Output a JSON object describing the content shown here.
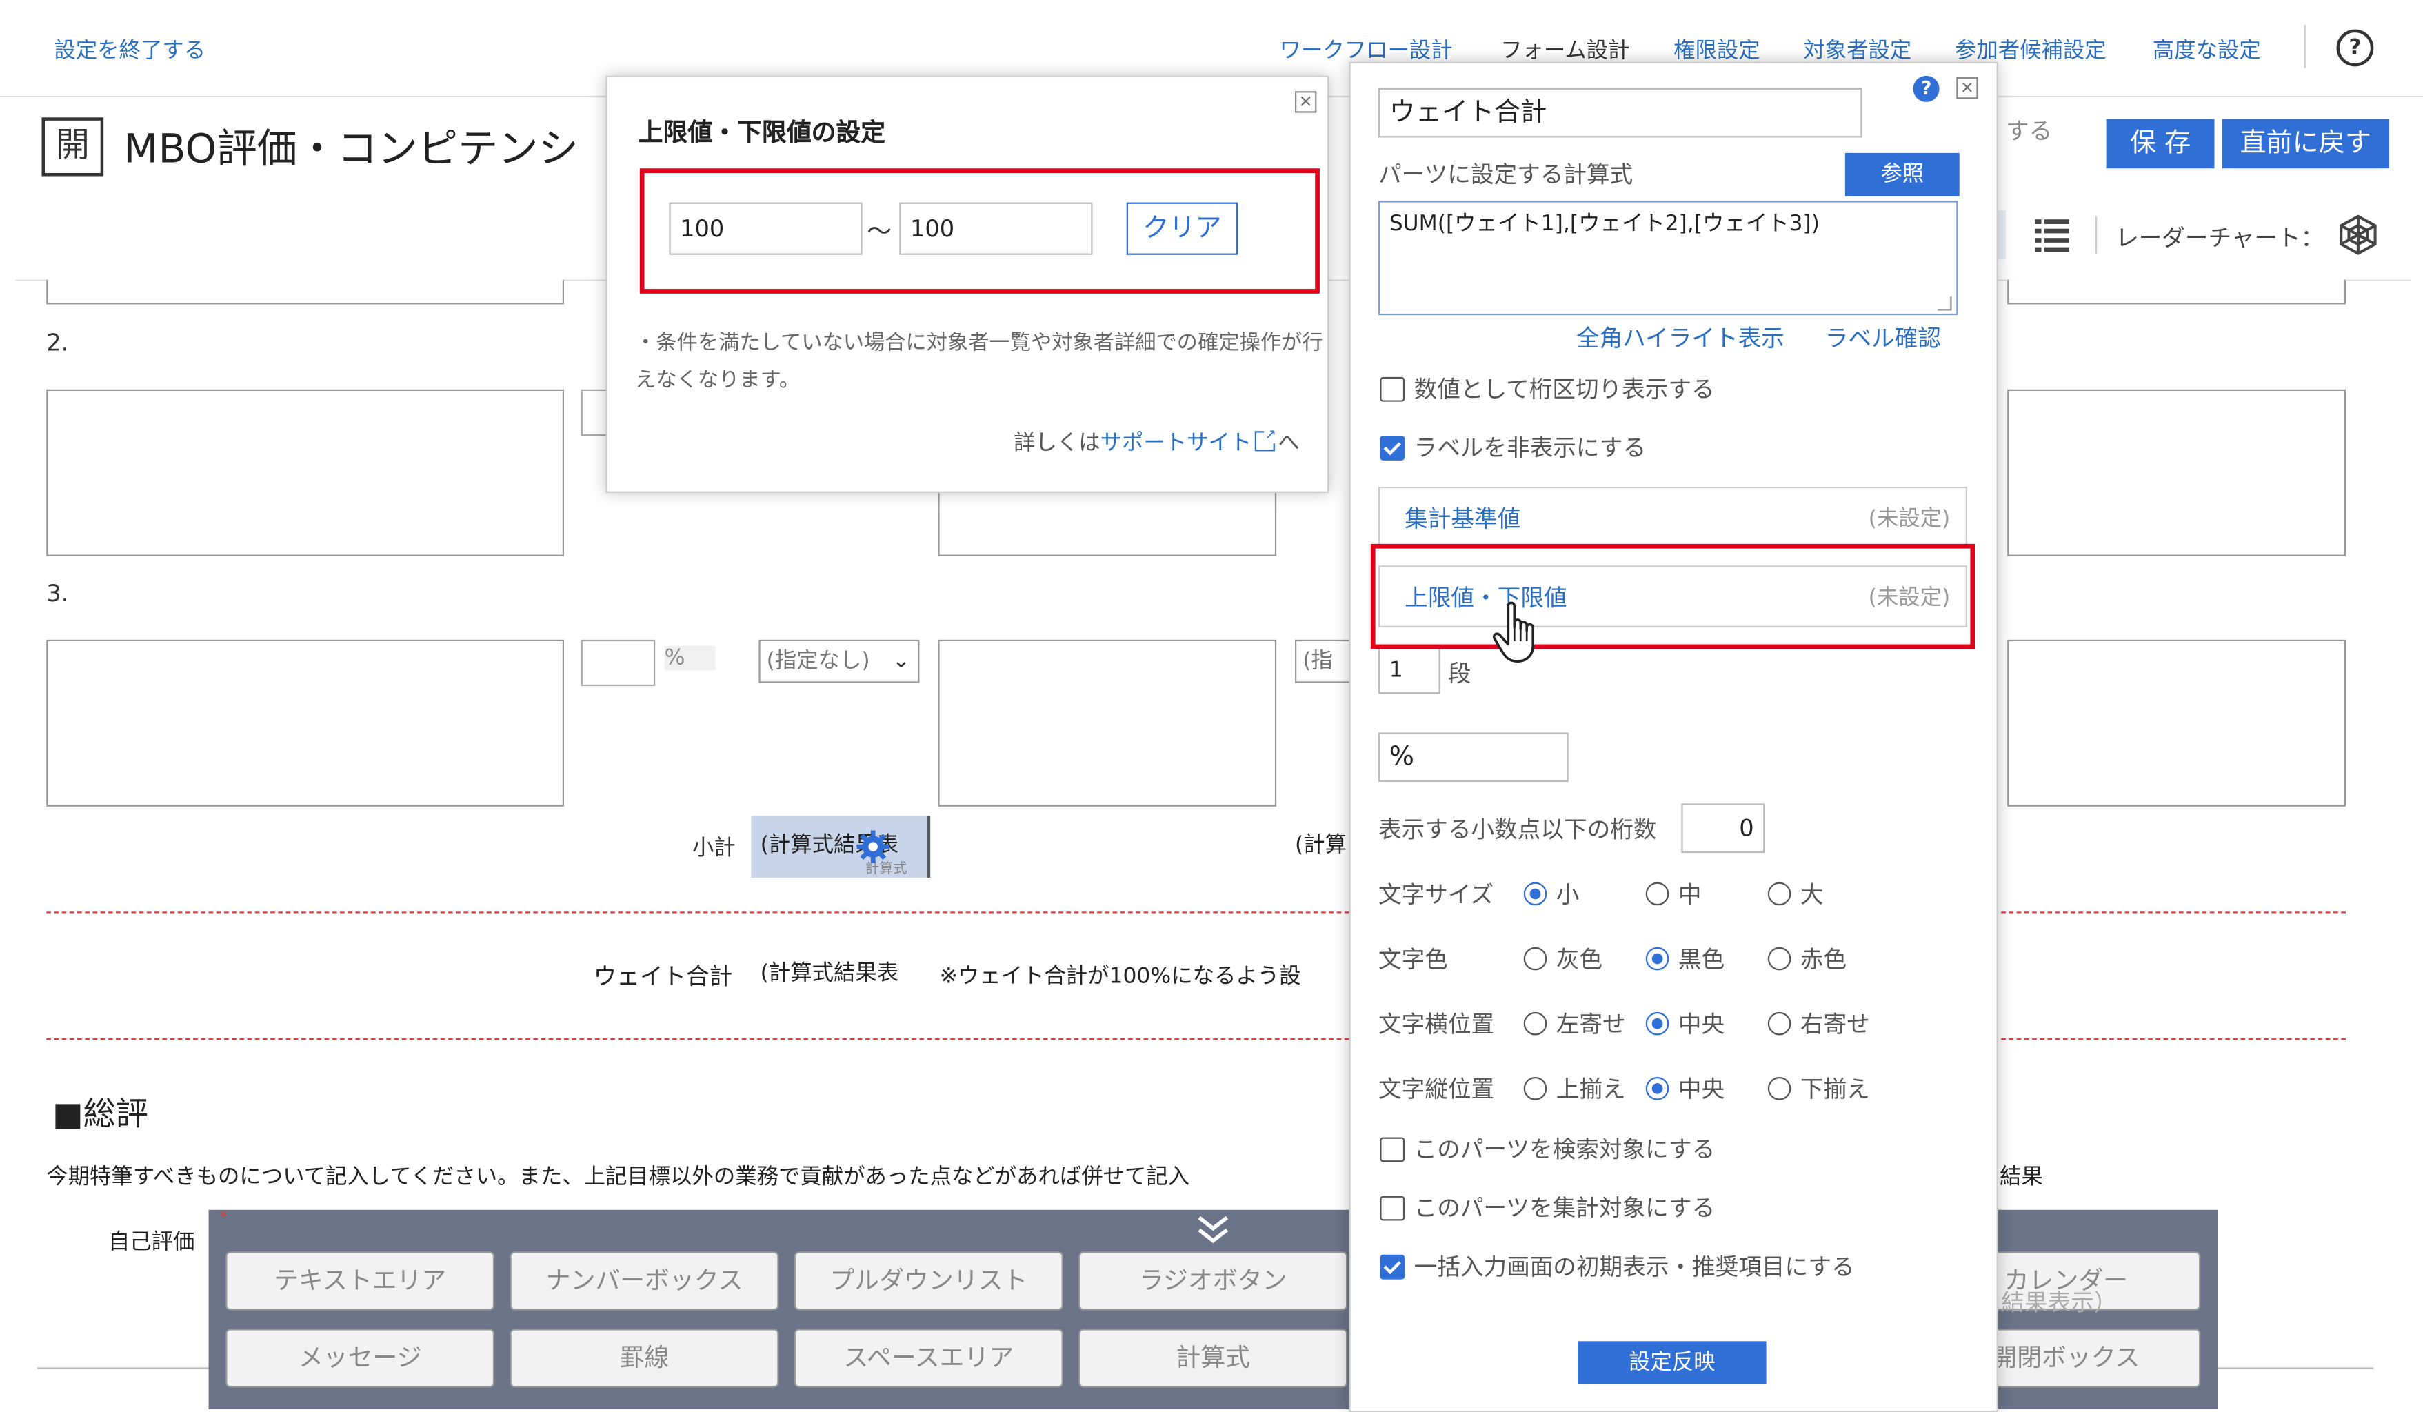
{
  "topbar": {
    "exit_link": "設定を終了する",
    "nav": [
      "ワークフロー設計",
      "フォーム設計",
      "権限設定",
      "対象者設定",
      "参加者候補設定",
      "高度な設定"
    ],
    "help_icon": "question-circle-icon"
  },
  "header": {
    "badge": "開",
    "title": "MBO評価・コンピテンシ",
    "partial_text": "する",
    "save_label": "保 存",
    "revert_label": "直前に戻す",
    "radar_label": "レーダーチャート：",
    "list_icon": "list-icon",
    "radar_icon": "hexagon-icon"
  },
  "form": {
    "row2_label": "2.",
    "row3_label": "3.",
    "percent": "%",
    "select_none": "(指定なし)",
    "select_partial": "(指定",
    "select_partial2": "(指",
    "subtotal_label": "小計",
    "subtotal_value": "(計算式結果表",
    "subtotal_sub": "計算式",
    "subtotal_partial": "(計算",
    "weight_label": "ウェイト合計",
    "weight_value": "(計算式結果表",
    "weight_note": "※ウェイト合計が100%になるよう設",
    "section_title": "■総評",
    "section_desc": "今期特筆すべきものについて記入してください。また、上記目標以外の業務で貢献があった点などがあれば併せて記入",
    "section_desc_tail": "結果",
    "self_eval": "自己評価",
    "behind_palette_1": "結果表示）"
  },
  "palette": {
    "collapse_icon": "double-chevron-down-icon",
    "row1": [
      "テキストエリア",
      "ナンバーボックス",
      "プルダウンリスト",
      "ラジオボタン"
    ],
    "row2": [
      "メッセージ",
      "罫線",
      "スペースエリア",
      "計算式"
    ],
    "right_row1": "カレンダー",
    "right_row2": "開閉ボックス"
  },
  "limit_popup": {
    "title": "上限値・下限値の設定",
    "close_icon": "close-icon",
    "lower_value": "100",
    "tilde": "～",
    "upper_value": "100",
    "clear_label": "クリア",
    "note": "・条件を満たしていない場合に対象者一覧や対象者詳細での確定操作が行えなくなります。",
    "more_prefix": "詳しくは",
    "more_link": "サポートサイト",
    "more_suffix": "へ",
    "external_icon": "external-link-icon"
  },
  "settings_panel": {
    "help_icon": "question-icon",
    "close_icon": "close-icon",
    "name_value": "ウェイト合計",
    "formula_label": "パーツに設定する計算式",
    "ref_label": "参照",
    "formula_value": "SUM([ウェイト1],[ウェイト2],[ウェイト3])",
    "highlight_link": "全角ハイライト表示",
    "label_check_link": "ラベル確認",
    "chk_separator": "数値として桁区切り表示する",
    "chk_hide_label": "ラベルを非表示にする",
    "agg_base_label": "集計基準値",
    "agg_base_status": "(未設定)",
    "limit_label": "上限値・下限値",
    "limit_status": "(未設定)",
    "rows_value": "1",
    "rows_unit": "段",
    "unit_value": "%",
    "decimals_label": "表示する小数点以下の桁数",
    "decimals_value": "0",
    "font_size_label": "文字サイズ",
    "font_size_options": [
      "小",
      "中",
      "大"
    ],
    "font_color_label": "文字色",
    "font_color_options": [
      "灰色",
      "黒色",
      "赤色"
    ],
    "halign_label": "文字横位置",
    "halign_options": [
      "左寄せ",
      "中央",
      "右寄せ"
    ],
    "valign_label": "文字縦位置",
    "valign_options": [
      "上揃え",
      "中央",
      "下揃え"
    ],
    "chk_search": "このパーツを検索対象にする",
    "chk_aggregate": "このパーツを集計対象にする",
    "chk_bulk": "一括入力画面の初期表示・推奨項目にする",
    "apply_label": "設定反映",
    "pointer_icon": "hand-pointer-icon",
    "checked": {
      "separator": false,
      "hide_label": true,
      "search": false,
      "aggregate": false,
      "bulk": true
    },
    "selected": {
      "font_size": 0,
      "font_color": 1,
      "halign": 1,
      "valign": 1
    }
  },
  "colors": {
    "accent": "#2f6fd6",
    "link": "#2a6fbf",
    "highlight_red": "#e0001a",
    "palette_bg": "#6a7388"
  }
}
